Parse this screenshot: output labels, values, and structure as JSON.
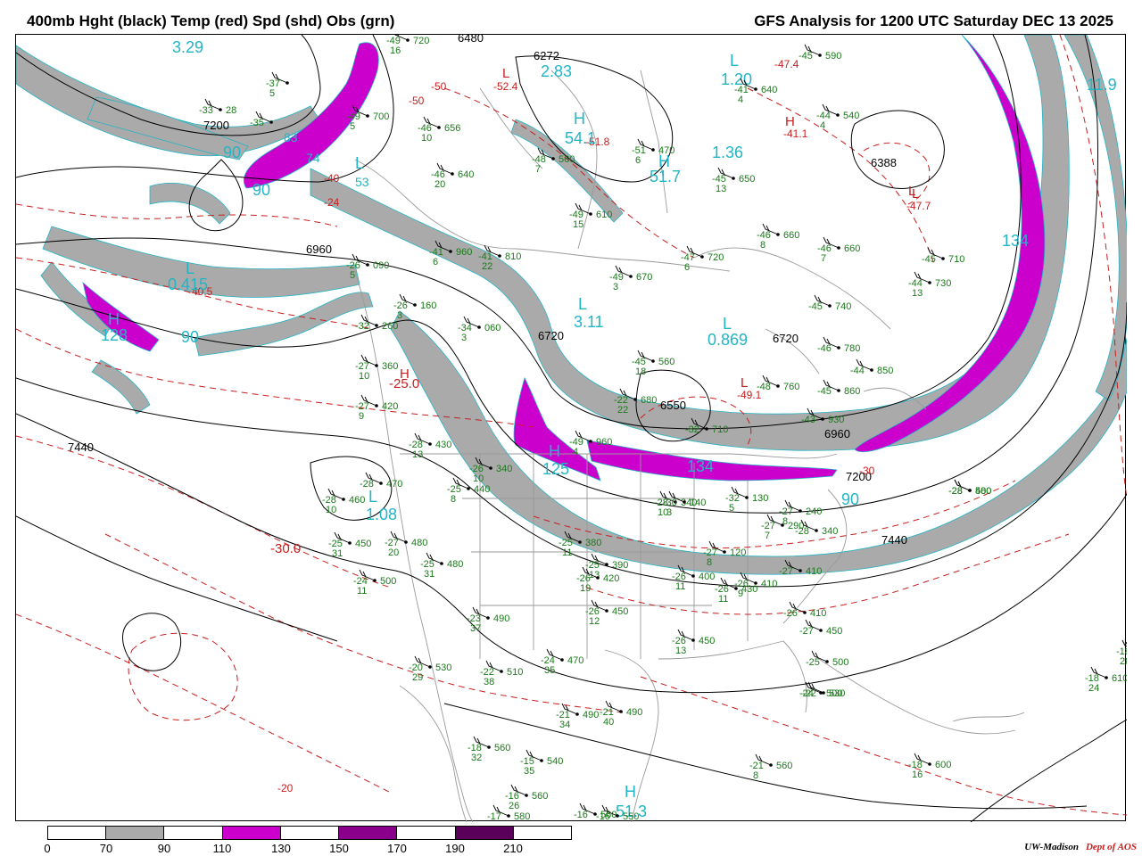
{
  "header": {
    "left_title": "400mb Hght (black) Temp (red) Spd (shd) Obs (grn)",
    "right_title": "GFS Analysis for 1200 UTC Saturday  DEC 13 2025"
  },
  "colors": {
    "height_contour": "#000000",
    "temperature_contour": "#c81e1e",
    "speed_70_90": "#aaaaaa",
    "speed_110_130": "#cc00cc",
    "speed_150_170": "#8a008a",
    "speed_190_210": "#5a005a",
    "observations": "#1a7a1a",
    "speed_labels": "#22b5c5",
    "borders": "#9a9a9a"
  },
  "height_labels": [
    "6480",
    "7200",
    "6960",
    "6720",
    "6550",
    "6388",
    "6720",
    "6960",
    "7200",
    "7440",
    "7440",
    "6272"
  ],
  "temp_labels": [
    "-47.4",
    "-52.4",
    "-51.8",
    "-41.1",
    "-47.7",
    "-49.1",
    "-40.5",
    "-25.0",
    "-30.0",
    "-30",
    "-20",
    "-50",
    "-50",
    "-40",
    "-24"
  ],
  "speed_labels": [
    "3.29",
    "2.83",
    "54.1",
    "51.7",
    "1.36",
    "1.20",
    "11.9",
    "134",
    "0.415",
    "128",
    "90",
    "90",
    "90",
    "3.11",
    "0.869",
    "125",
    "134",
    "1.08",
    "51.3",
    "90",
    "83",
    "74",
    "53"
  ],
  "pressure_centers": [
    "L",
    "H",
    "L",
    "H",
    "L",
    "H",
    "L",
    "L",
    "L",
    "H",
    "L",
    "L",
    "H",
    "H",
    "L",
    "H",
    "L"
  ],
  "observations": [
    {
      "t": "-49",
      "h": "720",
      "d": "16"
    },
    {
      "t": "-37",
      "h": "",
      "d": "5"
    },
    {
      "t": "-33",
      "h": "28",
      "d": ""
    },
    {
      "t": "-35",
      "h": "",
      "d": ""
    },
    {
      "t": "-49",
      "h": "700",
      "d": "5"
    },
    {
      "t": "-46",
      "h": "656",
      "d": "10"
    },
    {
      "t": "-48",
      "h": "560",
      "d": "7"
    },
    {
      "t": "-51",
      "h": "470",
      "d": "6"
    },
    {
      "t": "-45",
      "h": "590",
      "d": ""
    },
    {
      "t": "-41",
      "h": "640",
      "d": "4"
    },
    {
      "t": "-44",
      "h": "540",
      "d": "4"
    },
    {
      "t": "-46",
      "h": "640",
      "d": "20"
    },
    {
      "t": "-45",
      "h": "650",
      "d": "13"
    },
    {
      "t": "-49",
      "h": "610",
      "d": "15"
    },
    {
      "t": "-46",
      "h": "660",
      "d": "8"
    },
    {
      "t": "-47",
      "h": "720",
      "d": "6"
    },
    {
      "t": "-46",
      "h": "660",
      "d": "7"
    },
    {
      "t": "-45",
      "h": "710",
      "d": ""
    },
    {
      "t": "-44",
      "h": "730",
      "d": "13"
    },
    {
      "t": "-45",
      "h": "740",
      "d": ""
    },
    {
      "t": "-46",
      "h": "780",
      "d": ""
    },
    {
      "t": "-44",
      "h": "850",
      "d": ""
    },
    {
      "t": "-45",
      "h": "860",
      "d": ""
    },
    {
      "t": "-48",
      "h": "760",
      "d": ""
    },
    {
      "t": "-45",
      "h": "560",
      "d": "18"
    },
    {
      "t": "-43",
      "h": "930",
      "d": ""
    },
    {
      "t": "-49",
      "h": "670",
      "d": "3"
    },
    {
      "t": "-41",
      "h": "810",
      "d": "22"
    },
    {
      "t": "-41",
      "h": "960",
      "d": "6"
    },
    {
      "t": "-26",
      "h": "090",
      "d": "5"
    },
    {
      "t": "-26",
      "h": "160",
      "d": "3"
    },
    {
      "t": "-34",
      "h": "060",
      "d": "3"
    },
    {
      "t": "-32",
      "h": "260",
      "d": ""
    },
    {
      "t": "-27",
      "h": "360",
      "d": "10"
    },
    {
      "t": "-27",
      "h": "420",
      "d": "9"
    },
    {
      "t": "-28",
      "h": "430",
      "d": "13"
    },
    {
      "t": "-28",
      "h": "470",
      "d": ""
    },
    {
      "t": "-28",
      "h": "460",
      "d": "10"
    },
    {
      "t": "-25",
      "h": "450",
      "d": "31"
    },
    {
      "t": "-24",
      "h": "500",
      "d": "11"
    },
    {
      "t": "-27",
      "h": "480",
      "d": "20"
    },
    {
      "t": "-25",
      "h": "480",
      "d": "31"
    },
    {
      "t": "-25",
      "h": "440",
      "d": "8"
    },
    {
      "t": "-26",
      "h": "340",
      "d": "10"
    },
    {
      "t": "-25",
      "h": "380",
      "d": "11"
    },
    {
      "t": "-25",
      "h": "390",
      "d": "13"
    },
    {
      "t": "-26",
      "h": "420",
      "d": "19"
    },
    {
      "t": "-26",
      "h": "450",
      "d": "12"
    },
    {
      "t": "-23",
      "h": "490",
      "d": "37"
    },
    {
      "t": "-22",
      "h": "510",
      "d": "38"
    },
    {
      "t": "-20",
      "h": "530",
      "d": "29"
    },
    {
      "t": "-24",
      "h": "470",
      "d": "35"
    },
    {
      "t": "-21",
      "h": "490",
      "d": "34"
    },
    {
      "t": "-21",
      "h": "490",
      "d": "40"
    },
    {
      "t": "-18",
      "h": "560",
      "d": "32"
    },
    {
      "t": "-15",
      "h": "540",
      "d": "35"
    },
    {
      "t": "-16",
      "h": "560",
      "d": "26"
    },
    {
      "t": "-17",
      "h": "580",
      "d": ""
    },
    {
      "t": "-16",
      "h": "560",
      "d": ""
    },
    {
      "t": "-16",
      "h": "550",
      "d": ""
    },
    {
      "t": "-28",
      "h": "500",
      "d": ""
    },
    {
      "t": "-28",
      "h": "340",
      "d": "10"
    },
    {
      "t": "-30",
      "h": "140",
      "d": "3"
    },
    {
      "t": "-32",
      "h": "130",
      "d": "5"
    },
    {
      "t": "-27",
      "h": "120",
      "d": "8"
    },
    {
      "t": "-26",
      "h": "400",
      "d": "11"
    },
    {
      "t": "-26",
      "h": "430",
      "d": "11"
    },
    {
      "t": "-26",
      "h": "410",
      "d": "9"
    },
    {
      "t": "-27",
      "h": "410",
      "d": ""
    },
    {
      "t": "-26",
      "h": "410",
      "d": ""
    },
    {
      "t": "-27",
      "h": "450",
      "d": ""
    },
    {
      "t": "-25",
      "h": "500",
      "d": ""
    },
    {
      "t": "-24",
      "h": "500",
      "d": ""
    },
    {
      "t": "-26",
      "h": "450",
      "d": "13"
    },
    {
      "t": "-22",
      "h": "530",
      "d": ""
    },
    {
      "t": "-21",
      "h": "560",
      "d": "8"
    },
    {
      "t": "-18",
      "h": "600",
      "d": "16"
    },
    {
      "t": "-18",
      "h": "610",
      "d": "24"
    },
    {
      "t": "-18",
      "h": "",
      "d": "28"
    },
    {
      "t": "-28",
      "h": "480",
      "d": ""
    },
    {
      "t": "-27",
      "h": "290",
      "d": "7"
    },
    {
      "t": "-28",
      "h": "340",
      "d": ""
    },
    {
      "t": "-27",
      "h": "240",
      "d": "8"
    },
    {
      "t": "-32",
      "h": "710",
      "d": ""
    },
    {
      "t": "-22",
      "h": "680",
      "d": "22"
    },
    {
      "t": "-49",
      "h": "960",
      "d": "4"
    }
  ],
  "legend": {
    "ticks": [
      "0",
      "70",
      "90",
      "110",
      "130",
      "150",
      "170",
      "190",
      "210"
    ],
    "fills": [
      "#ffffff",
      "#aaaaaa",
      "#ffffff",
      "#cc00cc",
      "#ffffff",
      "#8a008a",
      "#ffffff",
      "#5a005a",
      "#ffffff"
    ]
  },
  "credit": {
    "org": "UW-Madison",
    "dept": "Dept of AOS"
  }
}
